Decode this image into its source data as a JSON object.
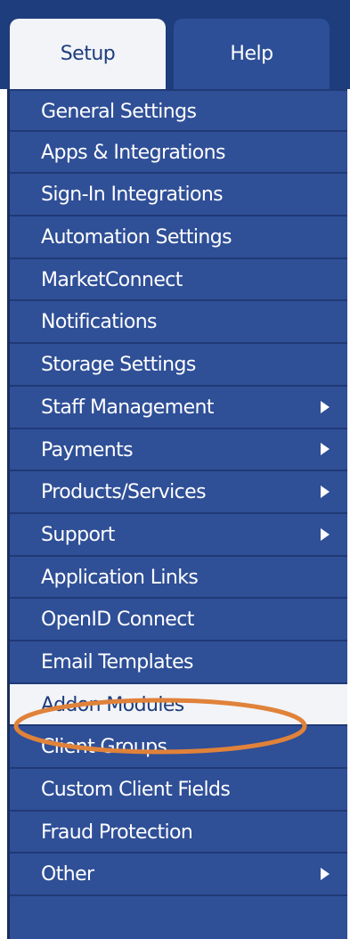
{
  "tabs": {
    "setup": "Setup",
    "help": "Help"
  },
  "menu": {
    "items": [
      {
        "label": "General Settings",
        "submenu": false,
        "active": false
      },
      {
        "label": "Apps & Integrations",
        "submenu": false,
        "active": false
      },
      {
        "label": "Sign-In Integrations",
        "submenu": false,
        "active": false
      },
      {
        "label": "Automation Settings",
        "submenu": false,
        "active": false
      },
      {
        "label": "MarketConnect",
        "submenu": false,
        "active": false
      },
      {
        "label": "Notifications",
        "submenu": false,
        "active": false
      },
      {
        "label": "Storage Settings",
        "submenu": false,
        "active": false
      },
      {
        "label": "Staff Management",
        "submenu": true,
        "active": false
      },
      {
        "label": "Payments",
        "submenu": true,
        "active": false
      },
      {
        "label": "Products/Services",
        "submenu": true,
        "active": false
      },
      {
        "label": "Support",
        "submenu": true,
        "active": false
      },
      {
        "label": "Application Links",
        "submenu": false,
        "active": false
      },
      {
        "label": "OpenID Connect",
        "submenu": false,
        "active": false
      },
      {
        "label": "Email Templates",
        "submenu": false,
        "active": false
      },
      {
        "label": "Addon Modules",
        "submenu": false,
        "active": true
      },
      {
        "label": "Client Groups",
        "submenu": false,
        "active": false
      },
      {
        "label": "Custom Client Fields",
        "submenu": false,
        "active": false
      },
      {
        "label": "Fraud Protection",
        "submenu": false,
        "active": false
      },
      {
        "label": "Other",
        "submenu": true,
        "active": false
      }
    ]
  },
  "colors": {
    "nav_background": "#1e3d7c",
    "menu_background": "#2f4f97",
    "active_background": "#f2f4f8",
    "highlight_annotation": "#e0823a"
  }
}
